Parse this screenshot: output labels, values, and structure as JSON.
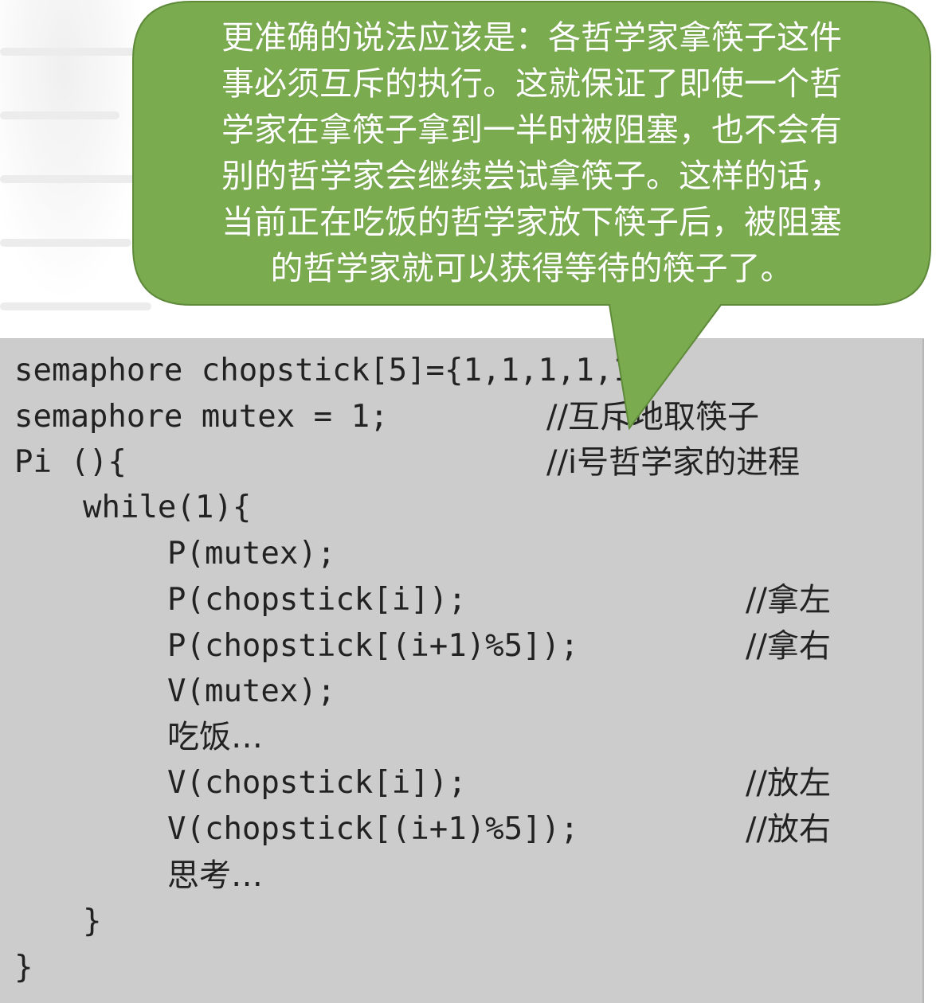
{
  "colors": {
    "callout_fill": "#7aab4f",
    "callout_stroke": "#5e8a3a",
    "code_bg": "#cccccc",
    "text": "#222222"
  },
  "callout": {
    "lines": [
      "更准确的说法应该是：各哲学家拿筷子这件",
      "事必须互斥的执行。这就保证了即使一个哲",
      "学家在拿筷子拿到一半时被阻塞，也不会有",
      "别的哲学家会继续尝试拿筷子。这样的话，",
      "当前正在吃饭的哲学家放下筷子后，被阻塞",
      "的哲学家就可以获得等待的筷子了。"
    ]
  },
  "code": {
    "lines": [
      {
        "code": "semaphore chopstick[5]={1,1,1,1,1};",
        "comment": ""
      },
      {
        "code": "semaphore mutex = 1;",
        "comment": "//互斥地取筷子"
      },
      {
        "code": "Pi (){",
        "comment": "//i号哲学家的进程"
      },
      {
        "code": "while(1){",
        "comment": ""
      },
      {
        "code": "P(mutex);",
        "comment": ""
      },
      {
        "code": "P(chopstick[i]);",
        "comment": "//拿左"
      },
      {
        "code": "P(chopstick[(i+1)%5]);",
        "comment": "//拿右"
      },
      {
        "code": "V(mutex);",
        "comment": ""
      },
      {
        "code": "吃饭…",
        "comment": ""
      },
      {
        "code": "V(chopstick[i]);",
        "comment": "//放左"
      },
      {
        "code": "V(chopstick[(i+1)%5]);",
        "comment": "//放右"
      },
      {
        "code": "思考…",
        "comment": ""
      },
      {
        "code": "}",
        "comment": ""
      },
      {
        "code": "}",
        "comment": ""
      }
    ]
  }
}
